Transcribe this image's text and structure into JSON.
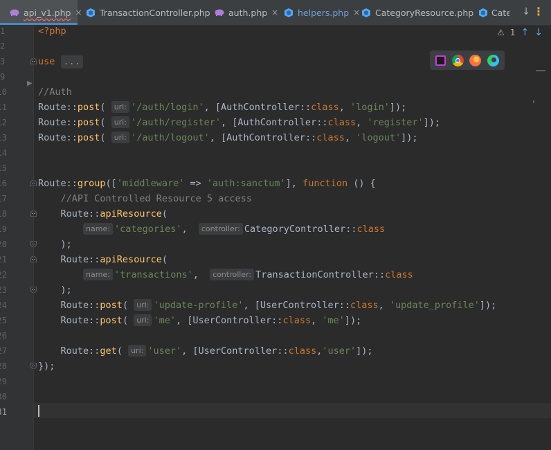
{
  "tabs": [
    {
      "label": "api_v1.php",
      "icon": "php-elephant-icon",
      "active": true,
      "underline": true
    },
    {
      "label": "TransactionController.php",
      "icon": "php-class-icon",
      "active": false
    },
    {
      "label": "auth.php",
      "icon": "php-elephant-icon",
      "active": false
    },
    {
      "label": "helpers.php",
      "icon": "php-class-icon",
      "active": false,
      "color": "#6f9fd8"
    },
    {
      "label": "CategoryResource.php",
      "icon": "php-class-icon",
      "active": false
    },
    {
      "label": "Cate",
      "icon": "php-class-icon",
      "active": false
    }
  ],
  "close_glyph": "×",
  "inspections": {
    "warning_count": "1"
  },
  "line_numbers": [
    "1",
    "2",
    "3",
    "9",
    "10",
    "11",
    "12",
    "13",
    "14",
    "15",
    "16",
    "17",
    "18",
    "19",
    "20",
    "21",
    "22",
    "23",
    "24",
    "25",
    "26",
    "27",
    "28",
    "29",
    "30",
    "31"
  ],
  "current_line": "31",
  "code": {
    "l1": "<?php",
    "l3_use": "use",
    "l3_folded": "...",
    "l10": "//Auth",
    "route": "Route",
    "dc": "::",
    "post": "post",
    "get": "get",
    "group": "group",
    "apiResource": "apiResource",
    "class_kw": "class",
    "function_kw": "function",
    "hint_uri": "uri:",
    "hint_name": "name:",
    "hint_controller": "controller:",
    "auth_login_uri": "'/auth/login'",
    "auth_login_method": "'login'",
    "auth_register_uri": "'/auth/register'",
    "auth_register_method": "'register'",
    "auth_logout_uri": "'/auth/logout'",
    "auth_logout_method": "'logout'",
    "auth_controller": "AuthController",
    "middleware_key": "'middleware'",
    "middleware_val": "'auth:sanctum'",
    "l17_comment": "//API Controlled Resource 5 access",
    "categories": "'categories'",
    "category_controller": "CategoryController",
    "transactions": "'transactions'",
    "transaction_controller": "TransactionController",
    "user_controller": "UserController",
    "update_profile_uri": "'update-profile'",
    "update_profile_method": "'update_profile'",
    "me": "'me'",
    "user": "'user'"
  },
  "colors": {
    "background": "#2b2b2b",
    "keyword": "#cc7832",
    "string": "#6a8759",
    "comment": "#808080",
    "function": "#ffc66d",
    "text": "#a9b7c6",
    "tab_accent": "#4a88c7"
  }
}
